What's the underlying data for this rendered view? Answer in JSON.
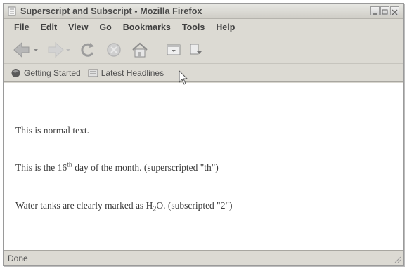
{
  "window": {
    "title": "Superscript and Subscript - Mozilla Firefox"
  },
  "menu": {
    "items": [
      "File",
      "Edit",
      "View",
      "Go",
      "Bookmarks",
      "Tools",
      "Help"
    ]
  },
  "toolbar": {
    "icons": [
      "back-arrow-icon",
      "forward-arrow-icon",
      "reload-icon",
      "stop-icon",
      "home-icon",
      "window-icon",
      "extension-icon"
    ]
  },
  "bookmarks": {
    "items": [
      {
        "label": "Getting Started",
        "icon": "firefox-bookmark-icon"
      },
      {
        "label": "Latest Headlines",
        "icon": "rss-feed-icon"
      }
    ]
  },
  "content": {
    "line1": "This is normal text.",
    "line2": {
      "before": "This is the 16",
      "sup": "th",
      "after": " day of the month. (superscripted \"th\")"
    },
    "line3": {
      "before": "Water tanks are clearly marked as H",
      "sub": "2",
      "after": "O. (subscripted \"2\")"
    }
  },
  "status": {
    "text": "Done"
  }
}
